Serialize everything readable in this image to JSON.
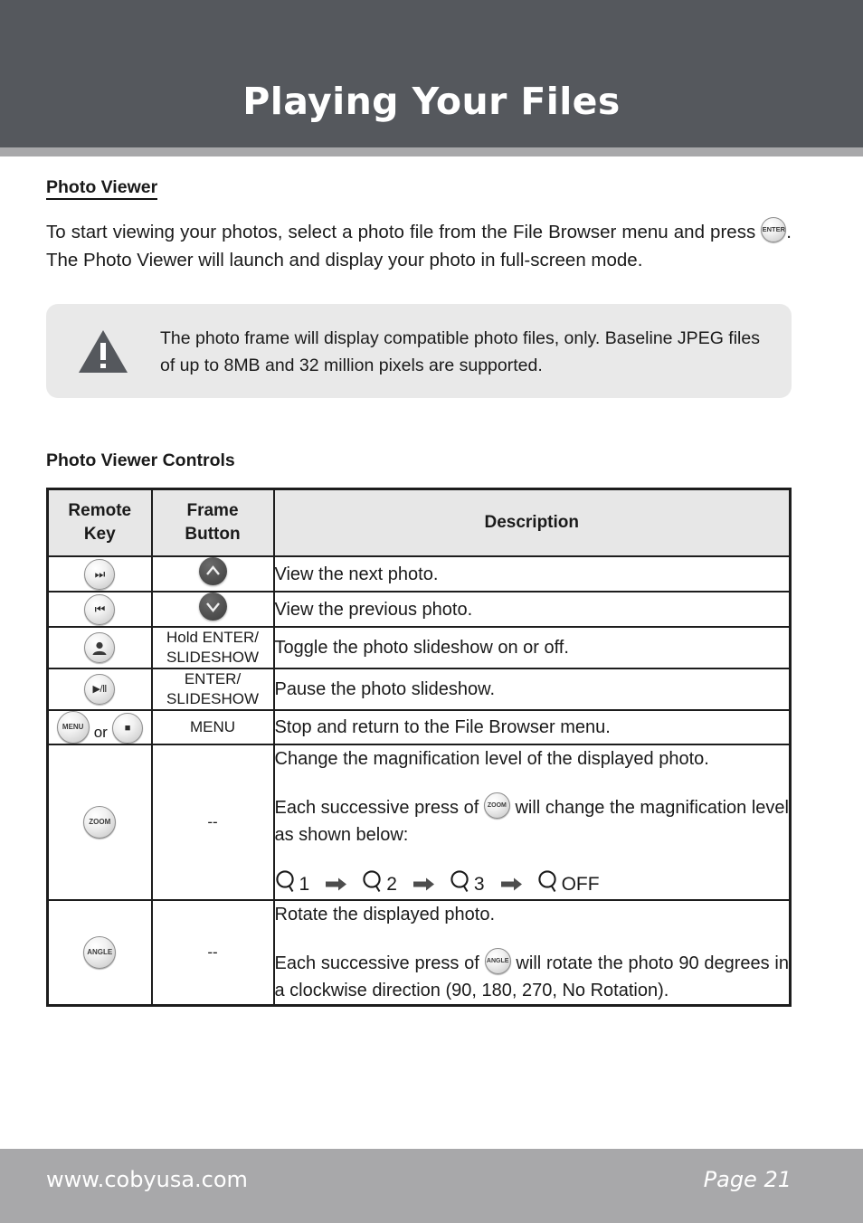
{
  "page": {
    "title": "Playing Your Files",
    "header_bg": "#55585d",
    "header_accent": "#a8a8aa"
  },
  "section": {
    "heading": "Photo Viewer",
    "intro_part1": "To start viewing your photos, select a photo file from the File Browser menu and press ",
    "intro_key": "ENTER",
    "intro_part2": ". The Photo Viewer will launch and display your photo in full-screen mode."
  },
  "note": {
    "icon": "warning-triangle-icon",
    "text": "The photo frame will display compatible photo files, only. Baseline JPEG files of up to 8MB and 32 million pixels are supported."
  },
  "table": {
    "caption": "Photo Viewer Controls",
    "headers": {
      "col1": "Remote Key",
      "col1_line1": "Remote",
      "col1_line2": "Key",
      "col2_line1": "Frame",
      "col2_line2": "Button",
      "col3": "Description"
    },
    "rows": [
      {
        "remote_key_icon": "next-track-button",
        "remote_key_glyph": "⏭",
        "frame_button_icon": "chevron-up-button",
        "frame_button_text": "",
        "description": "View the next photo."
      },
      {
        "remote_key_icon": "previous-track-button",
        "remote_key_glyph": "⏮",
        "frame_button_icon": "chevron-down-button",
        "frame_button_text": "",
        "description": "View the previous photo."
      },
      {
        "remote_key_icon": "slideshow-button",
        "remote_key_glyph": "",
        "frame_button_icon": "",
        "frame_button_line1": "Hold ENTER/",
        "frame_button_line2": "SLIDESHOW",
        "description": "Toggle the photo slideshow on or off."
      },
      {
        "remote_key_icon": "play-pause-button",
        "remote_key_glyph": "▶/Ⅱ",
        "frame_button_icon": "",
        "frame_button_line1": "ENTER/",
        "frame_button_line2": "SLIDESHOW",
        "description": "Pause the photo slideshow."
      },
      {
        "remote_key_icon": "menu-or-stop-button",
        "remote_key_label": "MENU",
        "remote_key_conjunction": "or",
        "remote_key_glyph2": "■",
        "frame_button_text": "MENU",
        "description": "Stop and return to the File Browser menu."
      },
      {
        "remote_key_icon": "zoom-button",
        "remote_key_label": "ZOOM",
        "frame_button_text": "--",
        "desc_line1": "Change the magnification level of the displayed photo.",
        "desc_line2_a": "Each successive press of ",
        "desc_line2_key": "ZOOM",
        "desc_line2_b": " will change the magnification level as shown below:",
        "zoom_sequence": [
          "1",
          "2",
          "3",
          "OFF"
        ]
      },
      {
        "remote_key_icon": "angle-button",
        "remote_key_label": "ANGLE",
        "frame_button_text": "--",
        "desc_line1": "Rotate the displayed photo.",
        "desc_line2_a": "Each successive press of ",
        "desc_line2_key": "ANGLE",
        "desc_line2_b": " will rotate the photo 90 degrees in a clockwise direction (90, 180, 270, No Rotation)."
      }
    ]
  },
  "footer": {
    "website": "www.cobyusa.com",
    "page_number": "Page 21"
  }
}
